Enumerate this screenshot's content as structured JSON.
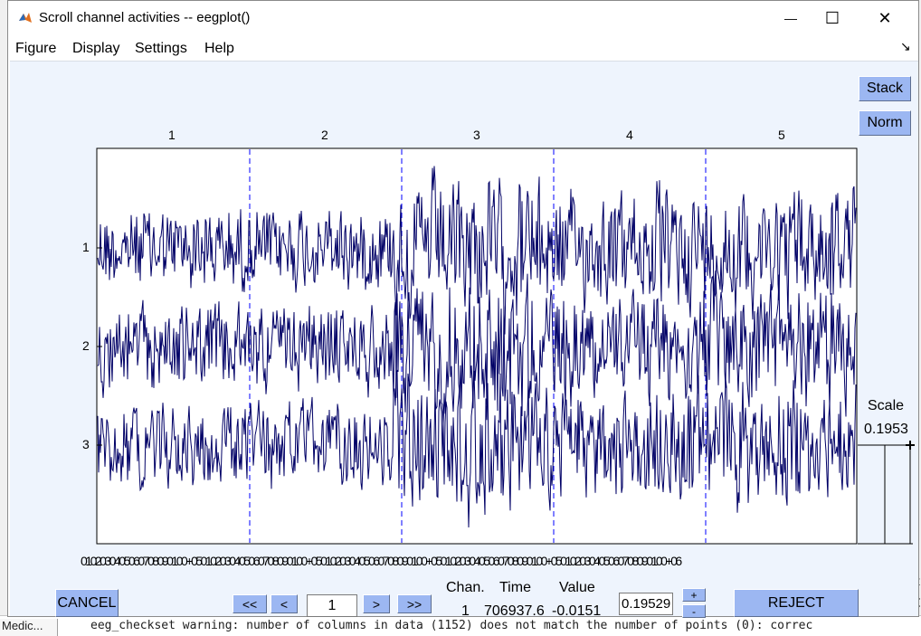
{
  "window": {
    "title": "Scroll channel activities -- eegplot()",
    "minimize_glyph": "—",
    "maximize_glyph": "☐",
    "close_glyph": "✕"
  },
  "menu": {
    "items": [
      "Figure",
      "Display",
      "Settings",
      "Help"
    ],
    "dock_arrow": "↘"
  },
  "buttons": {
    "stack": "Stack",
    "norm": "Norm",
    "cancel": "CANCEL",
    "reject": "REJECT",
    "first": "<<",
    "prev": "<",
    "next": ">",
    "last": ">>",
    "scale_plus": "+",
    "scale_minus": "-"
  },
  "plot": {
    "epoch_labels": [
      "1",
      "2",
      "3",
      "4",
      "5"
    ],
    "channel_labels": [
      "1",
      "2",
      "3"
    ],
    "xtick_text": "0102030405060708090100+050102030405060708090100+050102030405060708090100+050102030405060708090100+050102030405060708090100+06",
    "trace_color": "#000066",
    "epoch_marker_color": "#0000ff"
  },
  "scale": {
    "title": "Scale",
    "value": "0.1953"
  },
  "controls": {
    "page_value": "1",
    "chan_header": "Chan.",
    "time_header": "Time",
    "value_header": "Value",
    "chan_value": "1",
    "time_value": "706937.6",
    "value_value": "-0.0151",
    "scale_input": "0.19529"
  },
  "background": {
    "console_text": "eeg_checkset warning: number of columns in data (1152) does not match the number of points (0): correc",
    "tab_label": "Medic...",
    "right_char_a": "t",
    "right_char_b": "C"
  }
}
